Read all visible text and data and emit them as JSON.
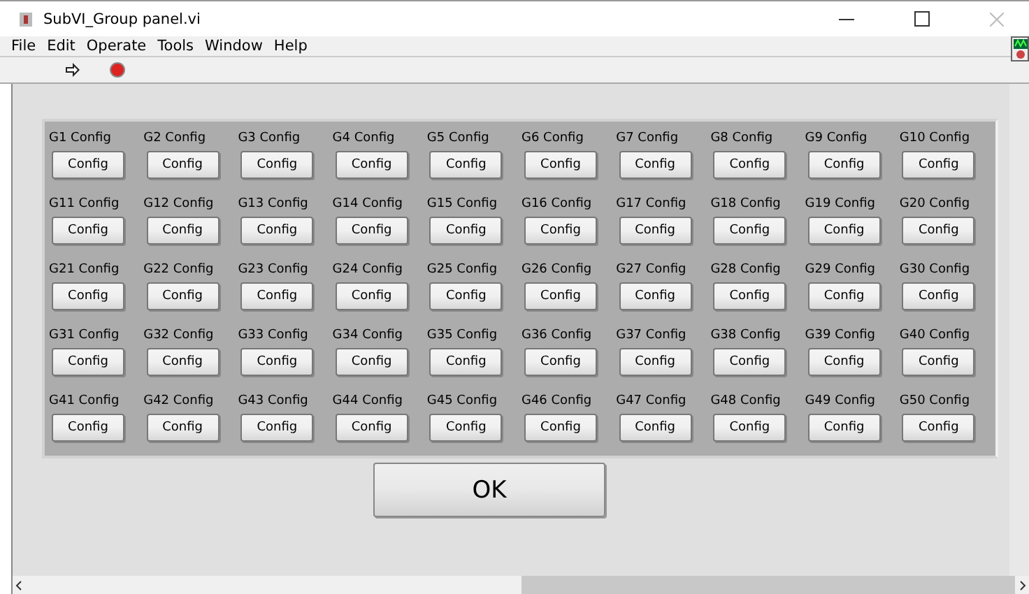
{
  "window": {
    "title": "SubVI_Group panel.vi"
  },
  "menu": [
    "File",
    "Edit",
    "Operate",
    "Tools",
    "Window",
    "Help"
  ],
  "groups": [
    {
      "label": "G1 Config",
      "button": "Config"
    },
    {
      "label": "G2 Config",
      "button": "Config"
    },
    {
      "label": "G3 Config",
      "button": "Config"
    },
    {
      "label": "G4 Config",
      "button": "Config"
    },
    {
      "label": "G5 Config",
      "button": "Config"
    },
    {
      "label": "G6 Config",
      "button": "Config"
    },
    {
      "label": "G7 Config",
      "button": "Config"
    },
    {
      "label": "G8 Config",
      "button": "Config"
    },
    {
      "label": "G9 Config",
      "button": "Config"
    },
    {
      "label": "G10 Config",
      "button": "Config"
    },
    {
      "label": "G11 Config",
      "button": "Config"
    },
    {
      "label": "G12 Config",
      "button": "Config"
    },
    {
      "label": "G13 Config",
      "button": "Config"
    },
    {
      "label": "G14 Config",
      "button": "Config"
    },
    {
      "label": "G15 Config",
      "button": "Config"
    },
    {
      "label": "G16 Config",
      "button": "Config"
    },
    {
      "label": "G17 Config",
      "button": "Config"
    },
    {
      "label": "G18 Config",
      "button": "Config"
    },
    {
      "label": "G19 Config",
      "button": "Config"
    },
    {
      "label": "G20 Config",
      "button": "Config"
    },
    {
      "label": "G21 Config",
      "button": "Config"
    },
    {
      "label": "G22 Config",
      "button": "Config"
    },
    {
      "label": "G23 Config",
      "button": "Config"
    },
    {
      "label": "G24 Config",
      "button": "Config"
    },
    {
      "label": "G25 Config",
      "button": "Config"
    },
    {
      "label": "G26 Config",
      "button": "Config"
    },
    {
      "label": "G27 Config",
      "button": "Config"
    },
    {
      "label": "G28 Config",
      "button": "Config"
    },
    {
      "label": "G29 Config",
      "button": "Config"
    },
    {
      "label": "G30 Config",
      "button": "Config"
    },
    {
      "label": "G31 Config",
      "button": "Config"
    },
    {
      "label": "G32 Config",
      "button": "Config"
    },
    {
      "label": "G33 Config",
      "button": "Config"
    },
    {
      "label": "G34 Config",
      "button": "Config"
    },
    {
      "label": "G35 Config",
      "button": "Config"
    },
    {
      "label": "G36 Config",
      "button": "Config"
    },
    {
      "label": "G37 Config",
      "button": "Config"
    },
    {
      "label": "G38 Config",
      "button": "Config"
    },
    {
      "label": "G39 Config",
      "button": "Config"
    },
    {
      "label": "G40 Config",
      "button": "Config"
    },
    {
      "label": "G41 Config",
      "button": "Config"
    },
    {
      "label": "G42 Config",
      "button": "Config"
    },
    {
      "label": "G43 Config",
      "button": "Config"
    },
    {
      "label": "G44 Config",
      "button": "Config"
    },
    {
      "label": "G45 Config",
      "button": "Config"
    },
    {
      "label": "G46 Config",
      "button": "Config"
    },
    {
      "label": "G47 Config",
      "button": "Config"
    },
    {
      "label": "G48 Config",
      "button": "Config"
    },
    {
      "label": "G49 Config",
      "button": "Config"
    },
    {
      "label": "G50 Config",
      "button": "Config"
    }
  ],
  "ok_button": "OK"
}
